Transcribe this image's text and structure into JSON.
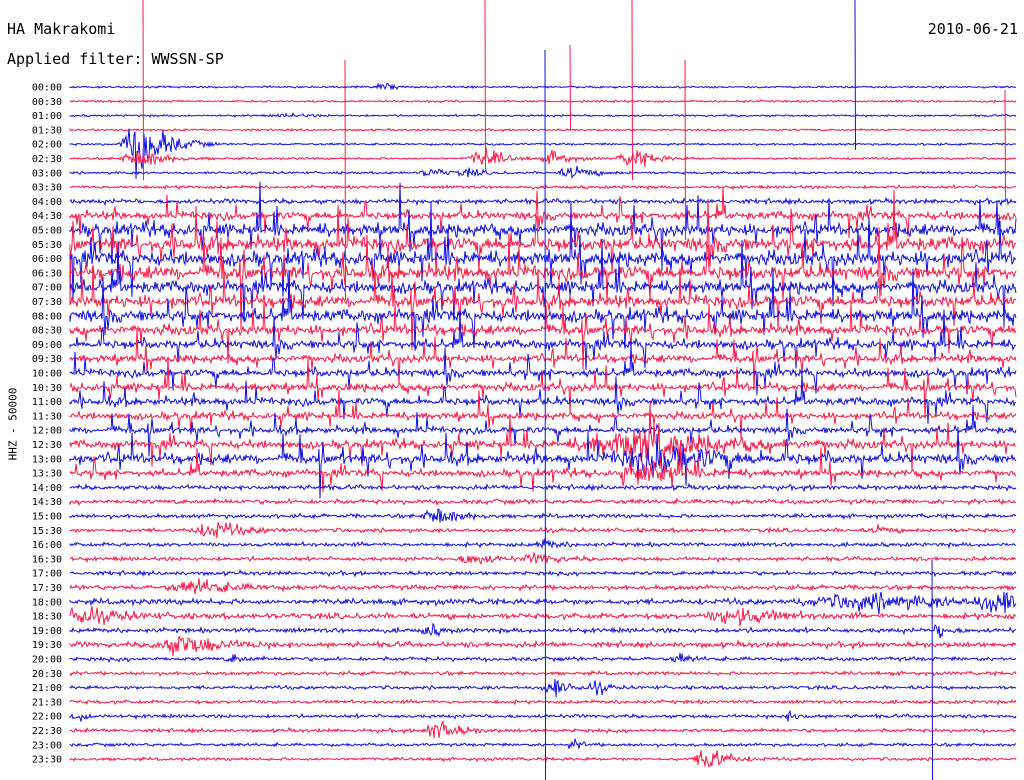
{
  "header": {
    "station": "HA Makrakomi",
    "filter": "Applied filter: WWSSN-SP",
    "date": "2010-06-21"
  },
  "axis": {
    "ylabel": "HHZ - 50000"
  },
  "colors": {
    "even": "#1010e0",
    "odd": "#ff1844",
    "background": "#ffffff",
    "text": "#000000"
  },
  "chart_data": {
    "type": "line",
    "title": "HA Makrakomi",
    "subtitle": "Applied filter: WWSSN-SP",
    "date": "2010-06-21",
    "ylabel": "HHZ - 50000",
    "xlabel": "",
    "grid": false,
    "legend": "none",
    "row_labels": [
      "00:00",
      "00:30",
      "01:00",
      "01:30",
      "02:00",
      "02:30",
      "03:00",
      "03:30",
      "04:00",
      "04:30",
      "05:00",
      "05:30",
      "06:00",
      "06:30",
      "07:00",
      "07:30",
      "08:00",
      "08:30",
      "09:00",
      "09:30",
      "10:00",
      "10:30",
      "11:00",
      "11:30",
      "12:00",
      "12:30",
      "13:00",
      "13:30",
      "14:00",
      "14:30",
      "15:00",
      "15:30",
      "16:00",
      "16:30",
      "17:00",
      "17:30",
      "18:00",
      "18:30",
      "19:00",
      "19:30",
      "20:00",
      "20:30",
      "21:00",
      "21:30",
      "22:00",
      "22:30",
      "23:00",
      "23:30"
    ],
    "row_colors": [
      "blue",
      "red",
      "blue",
      "red",
      "blue",
      "red",
      "blue",
      "red",
      "blue",
      "red",
      "blue",
      "red",
      "blue",
      "red",
      "blue",
      "red",
      "blue",
      "red",
      "blue",
      "red",
      "blue",
      "red",
      "blue",
      "red",
      "blue",
      "red",
      "blue",
      "red",
      "blue",
      "red",
      "blue",
      "red",
      "blue",
      "red",
      "blue",
      "red",
      "blue",
      "red",
      "blue",
      "red",
      "blue",
      "red",
      "blue",
      "red",
      "blue",
      "red",
      "blue",
      "red"
    ],
    "noise_level": [
      0.3,
      0.3,
      0.3,
      0.3,
      0.35,
      0.4,
      0.5,
      0.8,
      1.5,
      3,
      5,
      6,
      6,
      6,
      5,
      5,
      5,
      4,
      3.5,
      3,
      3,
      3,
      3,
      2.5,
      2.5,
      3,
      4,
      2.5,
      1.5,
      1.5,
      1.2,
      1.2,
      1.2,
      1.2,
      1.2,
      1.5,
      2,
      2,
      1.5,
      1.8,
      1.2,
      1,
      1,
      1,
      1,
      1,
      0.8,
      0.8
    ]
  }
}
